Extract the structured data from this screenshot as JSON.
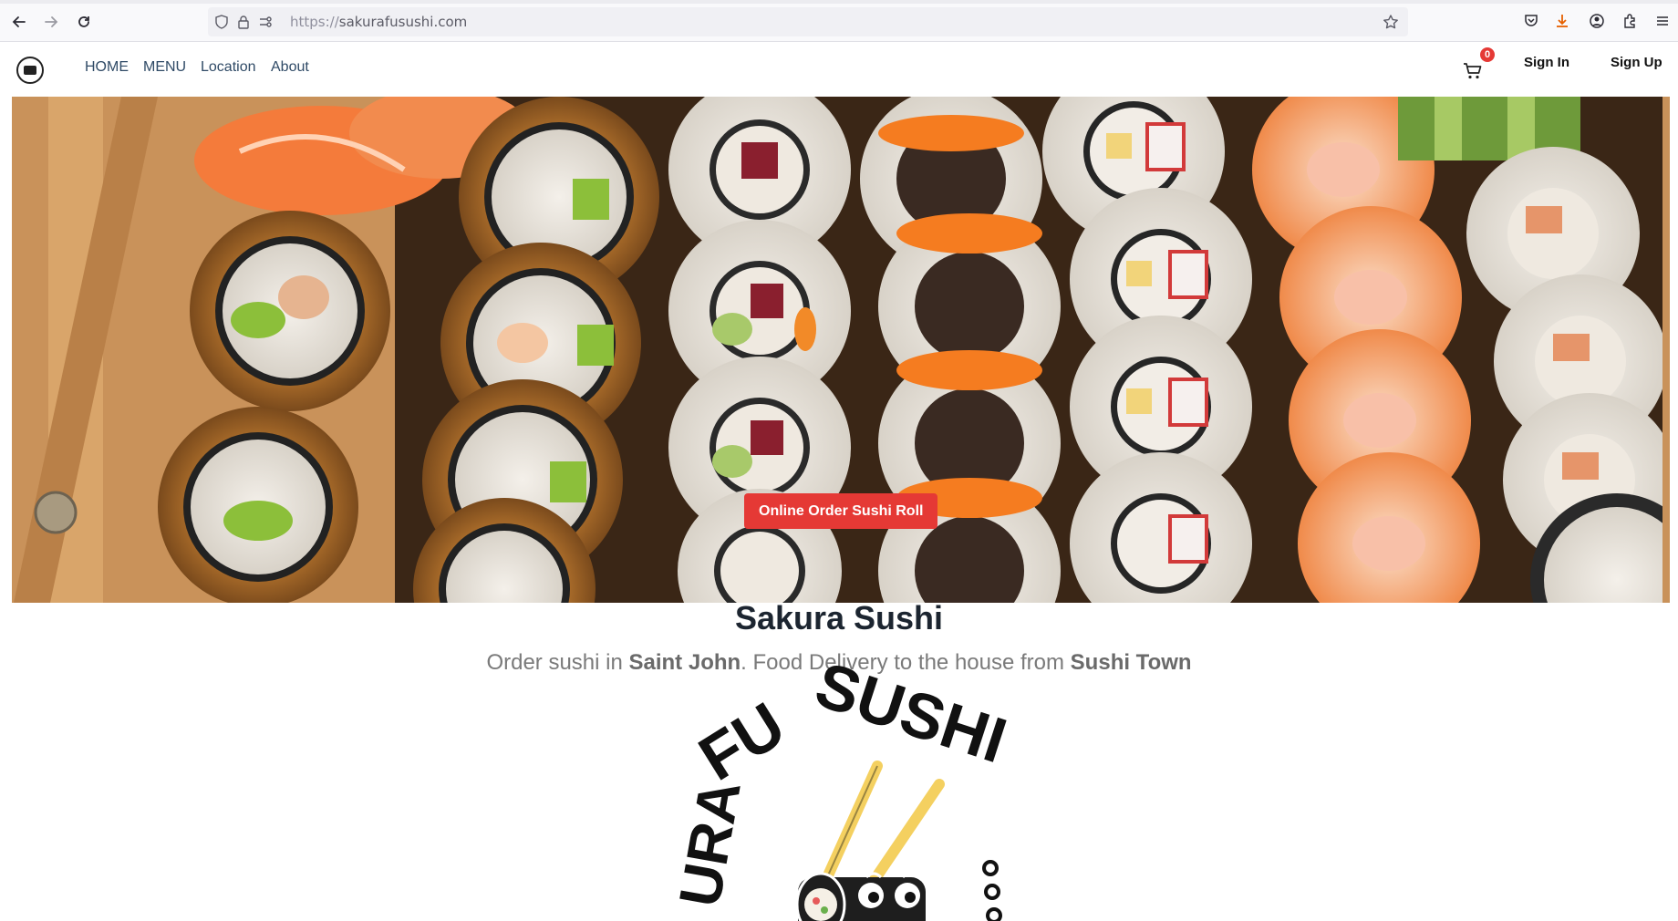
{
  "browser": {
    "url_scheme": "https://",
    "url_host": "sakurafusushi.com"
  },
  "site": {
    "nav": [
      "HOME",
      "MENU",
      "Location",
      "About"
    ],
    "cart_count": "0",
    "sign_in": "Sign In",
    "sign_up": "Sign Up"
  },
  "hero": {
    "button_label": "Online Order Sushi Roll"
  },
  "main": {
    "title": "Sakura Sushi",
    "subtitle_parts": [
      "Order sushi in ",
      "Saint John",
      ". Food Delivery to the house from ",
      "Sushi Town"
    ]
  },
  "logo": {
    "arc_text_left": "URA",
    "arc_text_top": "FU",
    "arc_text_right": "SUSHI"
  },
  "colors": {
    "accent": "#e53935",
    "nav_text": "#2f4a66"
  }
}
